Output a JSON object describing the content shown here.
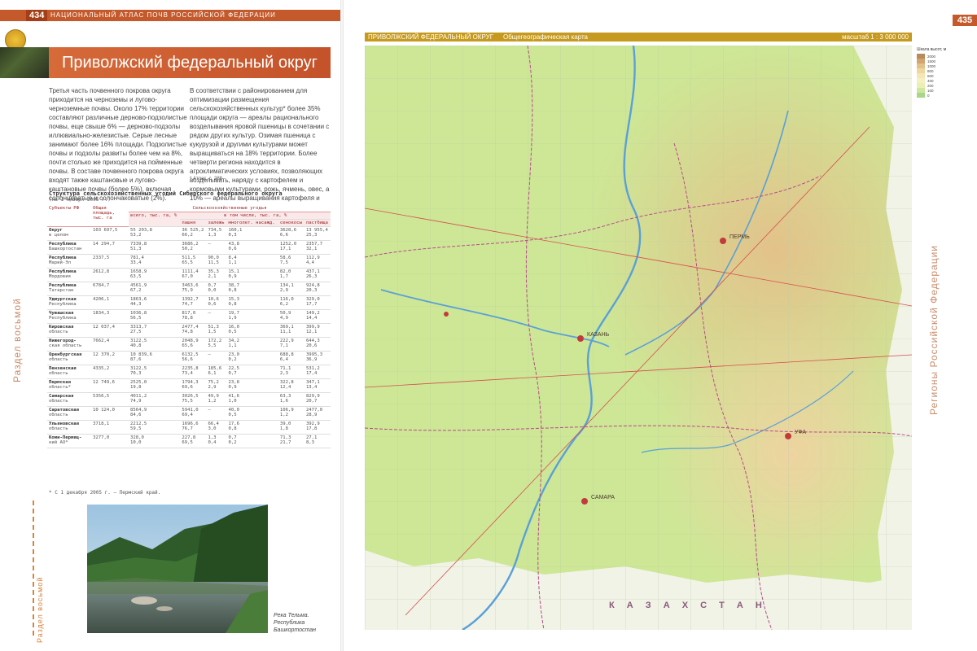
{
  "left_page": {
    "page_number": "434",
    "running_head": "НАЦИОНАЛЬНЫЙ АТЛАС ПОЧВ РОССИЙСКОЙ ФЕДЕРАЦИИ",
    "title": "Приволжский федеральный округ",
    "col1": "Третья часть почвенного покрова округа приходится на черноземы и лугово-черноземные почвы. Около 17% территории составляют различные дерново-подзолистые почвы, еще свыше 6% — дерново-подзолы иллювиально-железистые. Серые лесные занимают более 16% площади. Подзолистые почвы и подзолы развиты более чем на 8%, почти столько же приходится на пойменные почвы. В составе почвенного покрова округа входят также каштановые и лугово-каштановые почвы (более 5%), включая солонцеватые и солончаковатые (2%).",
    "col2": "В соответствии с районированием для оптимизации размещения сельскохозяйственных культур* более 35% площади округа — ареалы рационального возделывания яровой пшеницы в сочетании с рядом других культур. Озимая пшеница с кукурузой и другими культурами может выращиваться на 18% территории. Более четверти региона находится в агроклиматических условиях, позволяющих возделывать, наряду с картофелем и кормовыми культурами, рожь, ячмень, овес, а 10% — ареалы выращивания картофеля и кормовых культур.",
    "col_footnote": "* Атлас, с. 288",
    "side_label": "Раздел восьмой",
    "thumb_label": "Раздел восьмой",
    "table_caption": "Структура сельскохозяйственных угодий Сибирского федерального округа",
    "table_subcaption": "(на 1 января 2006 г.)",
    "table_header": {
      "subject": "Субъекты РФ",
      "total": "Общая площадь, тыс. га",
      "group": "Сельскохозяйственные угодья",
      "all": "всего, тыс. га, %",
      "incl": "в том числе, тыс. га, %",
      "cols": [
        "пашня",
        "залежь",
        "многолет. насажд.",
        "сенокосы",
        "пастбища"
      ]
    },
    "table_rows": [
      {
        "s1": "Округ",
        "s2": "в целом",
        "total": "103 697,5",
        "all": "55 203,8\n53,2",
        "c1": "36 525,2\n66,2",
        "c2": "734,5\n1,3",
        "c3": "160,1\n0,3",
        "c4": "3628,6\n6,6",
        "c5": "13 955,4\n25,3"
      },
      {
        "s1": "Республика",
        "s2": "Башкортостан",
        "total": "14 294,7",
        "all": "7339,8\n51,3",
        "c1": "3686,2\n50,2",
        "c2": "—",
        "c3": "43,8\n0,6",
        "c4": "1252,0\n17,1",
        "c5": "2357,7\n32,1"
      },
      {
        "s1": "Республика",
        "s2": "Марий-Эл",
        "total": "2337,5",
        "all": "781,4\n33,4",
        "c1": "511,5\n65,5",
        "c2": "90,0\n11,5",
        "c3": "8,4\n1,1",
        "c4": "58,6\n7,5",
        "c5": "112,9\n4,4"
      },
      {
        "s1": "Республика",
        "s2": "Мордовия",
        "total": "2612,8",
        "all": "1658,9\n63,5",
        "c1": "1111,4\n67,0",
        "c2": "35,3\n2,1",
        "c3": "15,1\n0,9",
        "c4": "82,0\n1,7",
        "c5": "437,1\n26,3"
      },
      {
        "s1": "Республика",
        "s2": "Татарстан",
        "total": "6784,7",
        "all": "4561,9\n67,2",
        "c1": "3463,6\n75,9",
        "c2": "0,7\n0,0",
        "c3": "38,7\n0,8",
        "c4": "134,1\n2,9",
        "c5": "924,8\n20,3"
      },
      {
        "s1": "Удмуртская",
        "s2": "Республика",
        "total": "4206,1",
        "all": "1863,6\n44,3",
        "c1": "1392,7\n74,7",
        "c2": "10,6\n0,6",
        "c3": "15,3\n0,8",
        "c4": "116,0\n6,2",
        "c5": "329,0\n17,7"
      },
      {
        "s1": "Чувашская",
        "s2": "Республика",
        "total": "1834,3",
        "all": "1036,8\n56,5",
        "c1": "817,0\n78,8",
        "c2": "—",
        "c3": "19,7\n1,9",
        "c4": "50,9\n4,9",
        "c5": "149,2\n14,4"
      },
      {
        "s1": "Кировская",
        "s2": "область",
        "total": "12 037,4",
        "all": "3313,7\n27,5",
        "c1": "2477,4\n74,8",
        "c2": "51,3\n1,5",
        "c3": "16,0\n0,5",
        "c4": "369,1\n11,1",
        "c5": "399,9\n12,1"
      },
      {
        "s1": "Нижегород-",
        "s2": "ская область",
        "total": "7662,4",
        "all": "3122,5\n40,8",
        "c1": "2048,9\n65,6",
        "c2": "172,2\n5,5",
        "c3": "34,2\n1,1",
        "c4": "222,9\n7,1",
        "c5": "644,3\n20,6"
      },
      {
        "s1": "Оренбургская",
        "s2": "область",
        "total": "12 370,2",
        "all": "10 839,6\n87,6",
        "c1": "6132,5\n56,6",
        "c2": "—",
        "c3": "23,0\n0,2",
        "c4": "688,8\n6,4",
        "c5": "3995,3\n36,9"
      },
      {
        "s1": "Пензенская",
        "s2": "область",
        "total": "4335,2",
        "all": "3122,5\n70,3",
        "c1": "2235,8\n73,4",
        "c2": "185,6\n6,1",
        "c3": "22,5\n0,7",
        "c4": "71,1\n2,3",
        "c5": "531,2\n17,4"
      },
      {
        "s1": "Пермская",
        "s2": "область*",
        "total": "12 749,6",
        "all": "2525,0\n19,8",
        "c1": "1794,3\n69,6",
        "c2": "75,2\n2,9",
        "c3": "23,8\n0,9",
        "c4": "322,8\n12,4",
        "c5": "347,1\n13,4"
      },
      {
        "s1": "Самарская",
        "s2": "область",
        "total": "5356,5",
        "all": "4011,2\n74,9",
        "c1": "3026,5\n75,5",
        "c2": "49,9\n1,2",
        "c3": "41,6\n1,0",
        "c4": "63,3\n1,6",
        "c5": "829,9\n20,7"
      },
      {
        "s1": "Саратовская",
        "s2": "область",
        "total": "10 124,0",
        "all": "8564,9\n84,6",
        "c1": "5941,0\n69,4",
        "c2": "—",
        "c3": "40,0\n0,5",
        "c4": "106,9\n1,2",
        "c5": "2477,0\n28,9"
      },
      {
        "s1": "Ульяновская",
        "s2": "область",
        "total": "3718,1",
        "all": "2212,5\n59,5",
        "c1": "1696,6\n76,7",
        "c2": "66,4\n3,0",
        "c3": "17,6\n0,8",
        "c4": "39,0\n1,8",
        "c5": "392,9\n17,8"
      },
      {
        "s1": "Коми-Пермяц-",
        "s2": "кий АО*",
        "total": "3277,0",
        "all": "328,0\n10,0",
        "c1": "227,8\n69,5",
        "c2": "1,3\n0,4",
        "c3": "0,7\n0,2",
        "c4": "71,3\n21,7",
        "c5": "27,1\n8,3"
      }
    ],
    "table_footnote": "* С 1 декабря 2005 г. — Пермский край.",
    "photo_caption": "Река Тельма.\nРеспублика\nБашкортостан"
  },
  "right_page": {
    "page_number": "435",
    "map_head_left": "ПРИВОЛЖСКИЙ ФЕДЕРАЛЬНЫЙ ОКРУГ",
    "map_head_mid": "Общегеографическая карта",
    "map_head_right": "масштаб 1 : 3 000 000",
    "side_label": "Регионы Российской Федерации",
    "legend_title": "Шкала высот, м",
    "legend": [
      {
        "label": "2000",
        "color": "#b98a5a"
      },
      {
        "label": "1500",
        "color": "#d2a56e"
      },
      {
        "label": "1000",
        "color": "#e3c28a"
      },
      {
        "label": "800",
        "color": "#efd8a0"
      },
      {
        "label": "600",
        "color": "#f4e7b4"
      },
      {
        "label": "400",
        "color": "#f6efc4"
      },
      {
        "label": "200",
        "color": "#e9f0b4"
      },
      {
        "label": "100",
        "color": "#cfe5a0"
      },
      {
        "label": "0",
        "color": "#a9d68a"
      }
    ],
    "map_labels": {
      "perm": "ПЕРМЬ",
      "kazan": "КАЗАНЬ",
      "samara": "САМАРА",
      "ufa": "УФА",
      "kazakhstan": "К А З А Х С Т А Н"
    }
  }
}
